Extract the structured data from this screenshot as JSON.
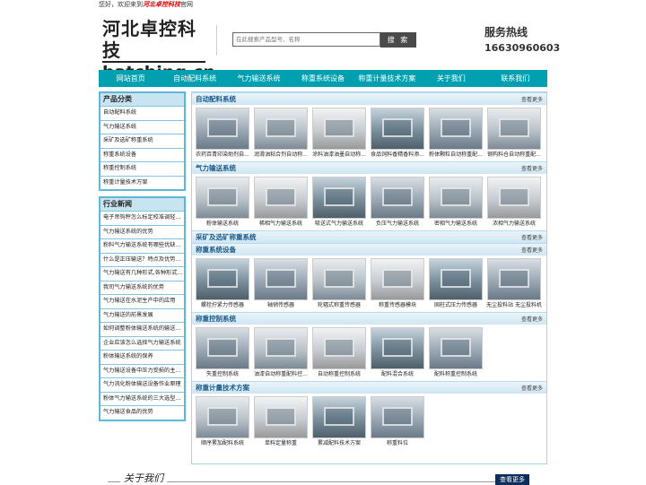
{
  "topbar": {
    "prefix": "您好，欢迎来到",
    "brand": "河北卓控科技",
    "suffix": "官网"
  },
  "logo": {
    "line1": "河北卓控科技",
    "line2": "batching.cn"
  },
  "search": {
    "placeholder": "在此搜索产品型号、名称",
    "button": "搜 索"
  },
  "hotline": {
    "label": "服务热线",
    "number": "16630960603"
  },
  "nav": [
    "网站首页",
    "自动配料系统",
    "气力输送系统",
    "称重系统设备",
    "称重计量技术方案",
    "关于我们",
    "联系我们"
  ],
  "sidebar": {
    "cat_title": "产品分类",
    "categories": [
      "自动配料系统",
      "气力输送系统",
      "采矿及选矿称重系统",
      "称重系统设备",
      "称重控制系统",
      "称重计量技术方案"
    ],
    "news_title": "行业新闻",
    "news": [
      "电子吊钩秤怎么标定校准调轻...",
      "气力输送系统的优势",
      "粉料气力输送系统有哪些优缺...",
      "什么是正压输送？特点及优势...",
      "气力输送有几种形式,各种形式...",
      "我司气力输送系统的优势",
      "气力输送在水泥生产中的应用",
      "气力输送的前景发展",
      "如何调整粉体输送系统的输送...",
      "企业应该怎么选择气力输送系统",
      "粉体输送系统的保养",
      "气力输送设备中压力受损的主...",
      "气力流化粉体输送设备作业原理",
      "粉体气力输送系统的三大选型...",
      "气力输送食品的优势"
    ]
  },
  "more": "查看更多",
  "sections": [
    {
      "title": "自动配料系统",
      "items": [
        "农药百青印染助剂自...",
        "润滑油粘合剂自动称...",
        "涂料油漆油墨自动称...",
        "食品饲料香精香料添...",
        "粉体颗粒自动称重配...",
        "钢构料仓自动称重配..."
      ]
    },
    {
      "title": "气力输送系统",
      "items": [
        "粉体输送系统",
        "稀相气力输送系统",
        "吸送式气力输送系统",
        "负压气力输送系统",
        "密相气力输送系统",
        "浓相气力输送系统"
      ]
    },
    {
      "title": "采矿及选矿称重系统",
      "items": []
    },
    {
      "title": "称重系统设备",
      "items": [
        "螺栓拧紧力传感器",
        "轴销传感器",
        "轮辐式称重传感器",
        "称重传感器模块",
        "固柱式压力传感器",
        "无尘投料站 无尘投料机"
      ]
    },
    {
      "title": "称重控制系统",
      "items": [
        "失重控制系统",
        "油漆自动称重配料控...",
        "自动称重控制系统",
        "配料混合系统",
        "配料称重控制系统"
      ]
    },
    {
      "title": "称重计量技术方案",
      "items": [
        "顺序累加配料系统",
        "单料定量称重",
        "累减配料技术方案",
        "称重料位"
      ]
    }
  ],
  "about": {
    "title": "关于我们",
    "more": "查看更多"
  }
}
